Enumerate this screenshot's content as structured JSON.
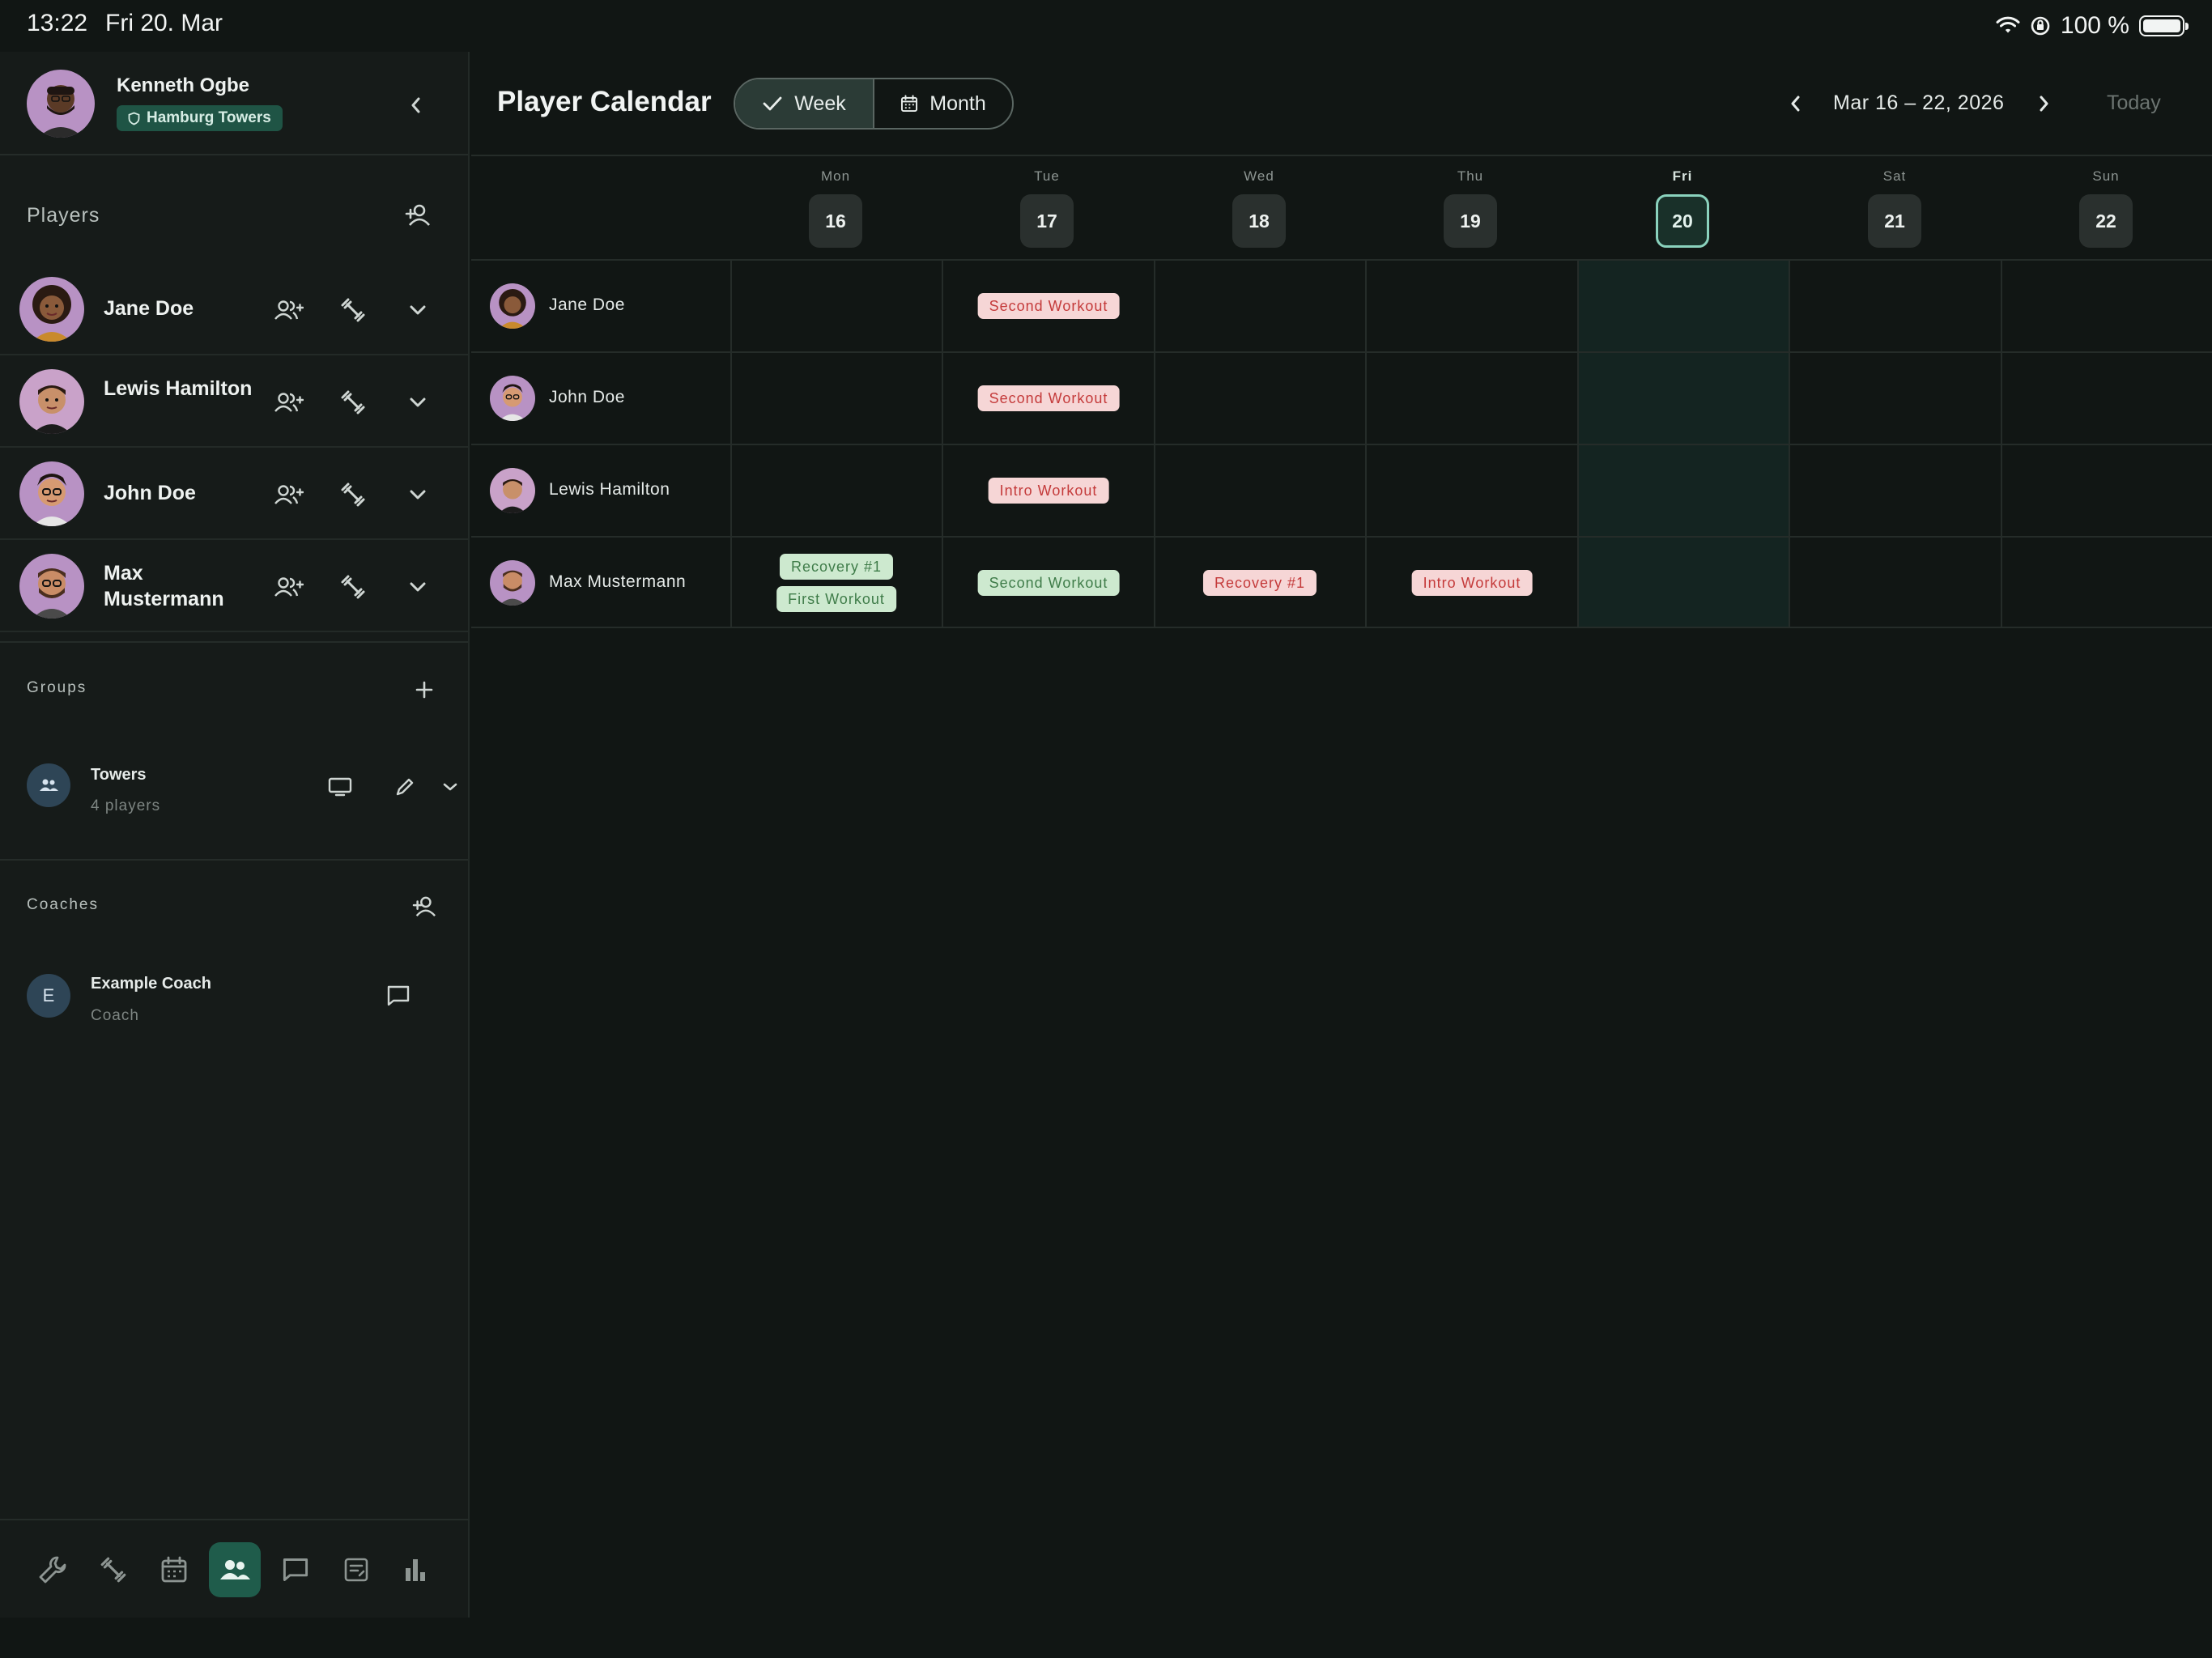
{
  "status_bar": {
    "time": "13:22",
    "date": "Fri 20. Mar",
    "battery": "100 %",
    "battery_level": 1.0
  },
  "profile": {
    "name": "Kenneth Ogbe",
    "team": "Hamburg Towers"
  },
  "players": {
    "title": "Players",
    "items": [
      {
        "name": "Jane Doe"
      },
      {
        "name": "Lewis Hamilton"
      },
      {
        "name": "John Doe"
      },
      {
        "name": "Max Mustermann"
      }
    ]
  },
  "groups": {
    "title": "Groups",
    "items": [
      {
        "name": "Towers",
        "subtitle": "4 players"
      }
    ]
  },
  "coaches": {
    "title": "Coaches",
    "items": [
      {
        "initial": "E",
        "name": "Example Coach",
        "role": "Coach"
      }
    ]
  },
  "nav": {
    "items": [
      {
        "icon": "wrench-icon",
        "active": false
      },
      {
        "icon": "dumbbell-icon",
        "active": false
      },
      {
        "icon": "calendar-icon",
        "active": false
      },
      {
        "icon": "people-icon",
        "active": true
      },
      {
        "icon": "chat-icon",
        "active": false
      },
      {
        "icon": "notes-icon",
        "active": false
      },
      {
        "icon": "bar-chart-icon",
        "active": false
      }
    ]
  },
  "calendar": {
    "title": "Player Calendar",
    "view_options": {
      "week": "Week",
      "month": "Month",
      "selected": "Week"
    },
    "range_label": "Mar 16 – 22, 2026",
    "today_label": "Today",
    "days": [
      {
        "name": "Mon",
        "num": "16",
        "today": false
      },
      {
        "name": "Tue",
        "num": "17",
        "today": false
      },
      {
        "name": "Wed",
        "num": "18",
        "today": false
      },
      {
        "name": "Thu",
        "num": "19",
        "today": false
      },
      {
        "name": "Fri",
        "num": "20",
        "today": true
      },
      {
        "name": "Sat",
        "num": "21",
        "today": false
      },
      {
        "name": "Sun",
        "num": "22",
        "today": false
      }
    ],
    "rows": [
      {
        "player": "Jane Doe"
      },
      {
        "player": "John Doe"
      },
      {
        "player": "Lewis Hamilton"
      },
      {
        "player": "Max Mustermann"
      }
    ],
    "events": {
      "jane_tue": {
        "label": "Second Workout",
        "status": "red"
      },
      "john_tue": {
        "label": "Second Workout",
        "status": "red"
      },
      "lewis_tue": {
        "label": "Intro Workout",
        "status": "red"
      },
      "max_mon_1": {
        "label": "Recovery #1",
        "status": "green"
      },
      "max_mon_2": {
        "label": "First Workout",
        "status": "green"
      },
      "max_tue": {
        "label": "Second Workout",
        "status": "green"
      },
      "max_wed": {
        "label": "Recovery #1",
        "status": "red"
      },
      "max_thu": {
        "label": "Intro Workout",
        "status": "red"
      }
    }
  },
  "colors": {
    "accent": "#1f5c4b",
    "today_outline": "#8ad2bd",
    "chip_red_bg": "#f6d6d6",
    "chip_green_bg": "#cde9cf"
  }
}
